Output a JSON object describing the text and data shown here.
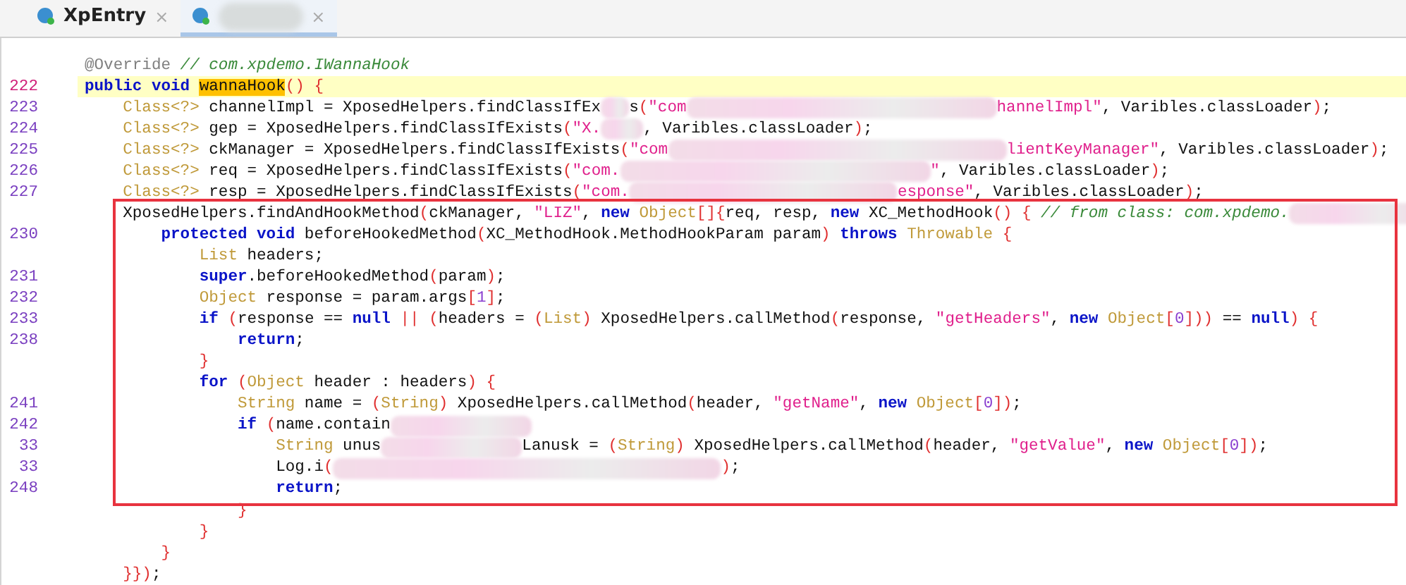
{
  "tabs": [
    {
      "label": "XpEntry",
      "close": "×",
      "selected": false
    },
    {
      "close": "×",
      "selected": true
    }
  ],
  "lines": [
    {
      "current": false,
      "tokens": [
        {
          "kind": "annotation",
          "text": "@Override "
        },
        {
          "kind": "comment",
          "text": "// com.xpdemo.IWannaHook"
        }
      ]
    },
    {
      "number": "222",
      "current": true,
      "tokens": [
        {
          "kind": "keyword",
          "text": "public "
        },
        {
          "kind": "keyword",
          "text": "void "
        },
        {
          "kind": "match",
          "text": "wannaHook"
        },
        {
          "kind": "bracket",
          "text": "() "
        },
        {
          "kind": "bracket",
          "text": "{"
        }
      ]
    },
    {
      "number": "223",
      "current": false,
      "tokens": [
        {
          "kind": "type",
          "text": "    Class<?>"
        },
        {
          "kind": "plain",
          "text": " channelImpl = XposedHelpers.findClassIfEx"
        },
        {
          "kind": "blurxs"
        },
        {
          "kind": "plain",
          "text": "s"
        },
        {
          "kind": "bracket",
          "text": "("
        },
        {
          "kind": "string",
          "text": "\"com"
        },
        {
          "kind": "blurxl"
        },
        {
          "kind": "string",
          "text": "hannelImpl\""
        },
        {
          "kind": "plain",
          "text": ", Varibles.classLoader"
        },
        {
          "kind": "bracket",
          "text": ")"
        },
        {
          "kind": "plain",
          "text": ";"
        }
      ]
    },
    {
      "number": "224",
      "current": false,
      "tokens": [
        {
          "kind": "type",
          "text": "    Class<?>"
        },
        {
          "kind": "plain",
          "text": " gep = XposedHelpers.findClassIfExists"
        },
        {
          "kind": "bracket",
          "text": "("
        },
        {
          "kind": "string",
          "text": "\"X."
        },
        {
          "kind": "blurs"
        },
        {
          "kind": "plain",
          "text": ", Varibles.classLoader"
        },
        {
          "kind": "bracket",
          "text": ")"
        },
        {
          "kind": "plain",
          "text": ";"
        }
      ]
    },
    {
      "number": "225",
      "current": false,
      "tokens": [
        {
          "kind": "type",
          "text": "    Class<?>"
        },
        {
          "kind": "plain",
          "text": " ckManager = XposedHelpers.findClassIfExists"
        },
        {
          "kind": "bracket",
          "text": "("
        },
        {
          "kind": "string",
          "text": "\"com"
        },
        {
          "kind": "blurxxl"
        },
        {
          "kind": "string",
          "text": "lientKeyManager\""
        },
        {
          "kind": "plain",
          "text": ", Varibles.classLoader"
        },
        {
          "kind": "bracket",
          "text": ")"
        },
        {
          "kind": "plain",
          "text": ";"
        }
      ]
    },
    {
      "number": "226",
      "current": false,
      "tokens": [
        {
          "kind": "type",
          "text": "    Class<?>"
        },
        {
          "kind": "plain",
          "text": " req = XposedHelpers.findClassIfExists"
        },
        {
          "kind": "bracket",
          "text": "("
        },
        {
          "kind": "string",
          "text": "\"com."
        },
        {
          "kind": "blurxl"
        },
        {
          "kind": "string",
          "text": "\""
        },
        {
          "kind": "plain",
          "text": ", Varibles.classLoader"
        },
        {
          "kind": "bracket",
          "text": ")"
        },
        {
          "kind": "plain",
          "text": ";"
        }
      ]
    },
    {
      "number": "227",
      "current": false,
      "tokens": [
        {
          "kind": "type",
          "text": "    Class<?>"
        },
        {
          "kind": "plain",
          "text": " resp = XposedHelpers.findClassIfExists"
        },
        {
          "kind": "bracket",
          "text": "("
        },
        {
          "kind": "string",
          "text": "\"com."
        },
        {
          "kind": "blurl"
        },
        {
          "kind": "string",
          "text": "esponse\""
        },
        {
          "kind": "plain",
          "text": ", Varibles.classLoader"
        },
        {
          "kind": "bracket",
          "text": ")"
        },
        {
          "kind": "plain",
          "text": ";"
        }
      ]
    },
    {
      "current": false,
      "tokens": [
        {
          "kind": "plain",
          "text": "    XposedHelpers.findAndHookMethod"
        },
        {
          "kind": "bracket",
          "text": "("
        },
        {
          "kind": "plain",
          "text": "ckManager, "
        },
        {
          "kind": "string",
          "text": "\"LIZ\""
        },
        {
          "kind": "plain",
          "text": ", "
        },
        {
          "kind": "keyword",
          "text": "new "
        },
        {
          "kind": "type",
          "text": "Object"
        },
        {
          "kind": "bracket",
          "text": "[]{"
        },
        {
          "kind": "plain",
          "text": "req, resp, "
        },
        {
          "kind": "keyword",
          "text": "new"
        },
        {
          "kind": "plain",
          "text": " XC_MethodHook"
        },
        {
          "kind": "bracket",
          "text": "() { "
        },
        {
          "kind": "comment",
          "text": "// from class: com.xpdemo."
        },
        {
          "kind": "blurm"
        }
      ]
    },
    {
      "number": "230",
      "current": false,
      "tokens": [
        {
          "kind": "keyword",
          "text": "        protected "
        },
        {
          "kind": "keyword",
          "text": "void"
        },
        {
          "kind": "plain",
          "text": " beforeHookedMethod"
        },
        {
          "kind": "bracket",
          "text": "("
        },
        {
          "kind": "plain",
          "text": "XC_MethodHook.MethodHookParam param"
        },
        {
          "kind": "bracket",
          "text": ") "
        },
        {
          "kind": "keyword",
          "text": "throws "
        },
        {
          "kind": "type",
          "text": "Throwable "
        },
        {
          "kind": "bracket",
          "text": "{"
        }
      ]
    },
    {
      "current": false,
      "tokens": [
        {
          "kind": "type",
          "text": "            List"
        },
        {
          "kind": "plain",
          "text": " headers;"
        }
      ]
    },
    {
      "number": "231",
      "current": false,
      "tokens": [
        {
          "kind": "keyword",
          "text": "            super"
        },
        {
          "kind": "plain",
          "text": ".beforeHookedMethod"
        },
        {
          "kind": "bracket",
          "text": "("
        },
        {
          "kind": "plain",
          "text": "param"
        },
        {
          "kind": "bracket",
          "text": ")"
        },
        {
          "kind": "plain",
          "text": ";"
        }
      ]
    },
    {
      "number": "232",
      "current": false,
      "tokens": [
        {
          "kind": "type",
          "text": "            Object"
        },
        {
          "kind": "plain",
          "text": " response = param.args"
        },
        {
          "kind": "bracket",
          "text": "["
        },
        {
          "kind": "number",
          "text": "1"
        },
        {
          "kind": "bracket",
          "text": "]"
        },
        {
          "kind": "plain",
          "text": ";"
        }
      ]
    },
    {
      "number": "233",
      "current": false,
      "tokens": [
        {
          "kind": "keyword",
          "text": "            if "
        },
        {
          "kind": "bracket",
          "text": "("
        },
        {
          "kind": "plain",
          "text": "response == "
        },
        {
          "kind": "keyword",
          "text": "null "
        },
        {
          "kind": "bracket",
          "text": "|| ("
        },
        {
          "kind": "plain",
          "text": "headers = "
        },
        {
          "kind": "bracket",
          "text": "("
        },
        {
          "kind": "type",
          "text": "List"
        },
        {
          "kind": "bracket",
          "text": ")"
        },
        {
          "kind": "plain",
          "text": " XposedHelpers.callMethod"
        },
        {
          "kind": "bracket",
          "text": "("
        },
        {
          "kind": "plain",
          "text": "response, "
        },
        {
          "kind": "string",
          "text": "\"getHeaders\""
        },
        {
          "kind": "plain",
          "text": ", "
        },
        {
          "kind": "keyword",
          "text": "new "
        },
        {
          "kind": "type",
          "text": "Object"
        },
        {
          "kind": "bracket",
          "text": "["
        },
        {
          "kind": "number",
          "text": "0"
        },
        {
          "kind": "bracket",
          "text": "]))"
        },
        {
          "kind": "plain",
          "text": " == "
        },
        {
          "kind": "keyword",
          "text": "null"
        },
        {
          "kind": "bracket",
          "text": ") {"
        }
      ]
    },
    {
      "number": "238",
      "current": false,
      "tokens": [
        {
          "kind": "keyword",
          "text": "                return"
        },
        {
          "kind": "plain",
          "text": ";"
        }
      ]
    },
    {
      "current": false,
      "tokens": [
        {
          "kind": "bracket",
          "text": "            }"
        }
      ]
    },
    {
      "current": false,
      "tokens": [
        {
          "kind": "keyword",
          "text": "            for "
        },
        {
          "kind": "bracket",
          "text": "("
        },
        {
          "kind": "type",
          "text": "Object"
        },
        {
          "kind": "plain",
          "text": " header : headers"
        },
        {
          "kind": "bracket",
          "text": ") {"
        }
      ]
    },
    {
      "number": "241",
      "current": false,
      "tokens": [
        {
          "kind": "type",
          "text": "                String"
        },
        {
          "kind": "plain",
          "text": " name = "
        },
        {
          "kind": "bracket",
          "text": "("
        },
        {
          "kind": "type",
          "text": "String"
        },
        {
          "kind": "bracket",
          "text": ")"
        },
        {
          "kind": "plain",
          "text": " XposedHelpers.callMethod"
        },
        {
          "kind": "bracket",
          "text": "("
        },
        {
          "kind": "plain",
          "text": "header, "
        },
        {
          "kind": "string",
          "text": "\"getName\""
        },
        {
          "kind": "plain",
          "text": ", "
        },
        {
          "kind": "keyword",
          "text": "new "
        },
        {
          "kind": "type",
          "text": "Object"
        },
        {
          "kind": "bracket",
          "text": "["
        },
        {
          "kind": "number",
          "text": "0"
        },
        {
          "kind": "bracket",
          "text": "])"
        },
        {
          "kind": "plain",
          "text": ";"
        }
      ]
    },
    {
      "number": "242",
      "current": false,
      "tokens": [
        {
          "kind": "keyword",
          "text": "                if "
        },
        {
          "kind": "bracket",
          "text": "("
        },
        {
          "kind": "plain",
          "text": "name.contain"
        },
        {
          "kind": "blurm"
        }
      ]
    },
    {
      "number": "33",
      "current": false,
      "tokens": [
        {
          "kind": "type",
          "text": "                    String"
        },
        {
          "kind": "plain",
          "text": " unus"
        },
        {
          "kind": "blurm"
        },
        {
          "kind": "plain",
          "text": "Lanusk = "
        },
        {
          "kind": "bracket",
          "text": "("
        },
        {
          "kind": "type",
          "text": "String"
        },
        {
          "kind": "bracket",
          "text": ")"
        },
        {
          "kind": "plain",
          "text": " XposedHelpers.callMethod"
        },
        {
          "kind": "bracket",
          "text": "("
        },
        {
          "kind": "plain",
          "text": "header, "
        },
        {
          "kind": "string",
          "text": "\"getValue\""
        },
        {
          "kind": "plain",
          "text": ", "
        },
        {
          "kind": "keyword",
          "text": "new "
        },
        {
          "kind": "type",
          "text": "Object"
        },
        {
          "kind": "bracket",
          "text": "["
        },
        {
          "kind": "number",
          "text": "0"
        },
        {
          "kind": "bracket",
          "text": "])"
        },
        {
          "kind": "plain",
          "text": ";"
        }
      ]
    },
    {
      "number": "33",
      "current": false,
      "tokens": [
        {
          "kind": "plain",
          "text": "                    Log.i"
        },
        {
          "kind": "bracket",
          "text": "("
        },
        {
          "kind": "blurhuge"
        },
        {
          "kind": "bracket",
          "text": ")"
        },
        {
          "kind": "plain",
          "text": ";"
        }
      ]
    },
    {
      "number": "248",
      "current": false,
      "tokens": [
        {
          "kind": "keyword",
          "text": "                    return"
        },
        {
          "kind": "plain",
          "text": ";"
        }
      ]
    },
    {
      "current": false,
      "tokens": [
        {
          "kind": "bracket",
          "text": "                }"
        }
      ]
    },
    {
      "current": false,
      "tokens": [
        {
          "kind": "bracket",
          "text": "            }"
        }
      ]
    },
    {
      "current": false,
      "tokens": [
        {
          "kind": "bracket",
          "text": "        }"
        }
      ]
    },
    {
      "current": false,
      "tokens": [
        {
          "kind": "bracket",
          "text": "    }})"
        },
        {
          "kind": "plain",
          "text": ";"
        }
      ]
    }
  ]
}
